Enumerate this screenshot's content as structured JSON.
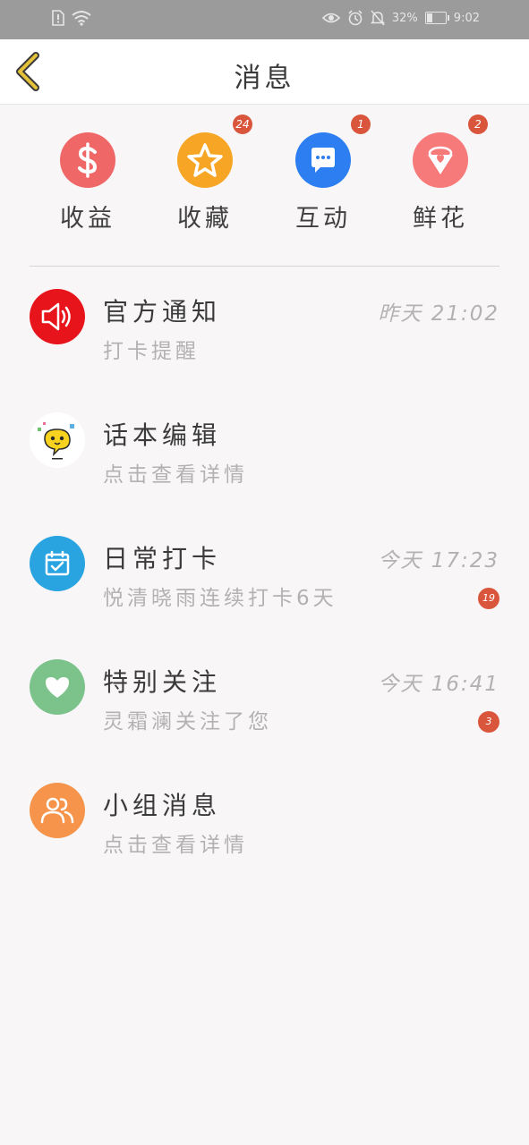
{
  "status_bar": {
    "battery_percent": "32%",
    "time": "9:02"
  },
  "header": {
    "title": "消息",
    "back_icon": "chevron-left-icon",
    "back_color": "#e3c13a"
  },
  "quick_actions": [
    {
      "label": "收益",
      "icon": "dollar-icon",
      "color": "#f06767",
      "badge": ""
    },
    {
      "label": "收藏",
      "icon": "star-icon",
      "color": "#f7a524",
      "badge": "24"
    },
    {
      "label": "互动",
      "icon": "chat-bubble-icon",
      "color": "#2d7ff1",
      "badge": "1"
    },
    {
      "label": "鲜花",
      "icon": "flower-bouquet-icon",
      "color": "#f77a7a",
      "badge": "2"
    }
  ],
  "messages": [
    {
      "title": "官方通知",
      "subtitle": "打卡提醒",
      "time": "昨天  21:02",
      "badge": "",
      "icon": "speaker-icon",
      "color": "#e8141c"
    },
    {
      "title": "话本编辑",
      "subtitle": "点击查看详情",
      "time": "",
      "badge": "",
      "icon": "emoji-chat-icon",
      "color": "#ffffff"
    },
    {
      "title": "日常打卡",
      "subtitle": "悦清晓雨连续打卡6天",
      "time": "今天  17:23",
      "badge": "19",
      "icon": "calendar-check-icon",
      "color": "#29a4e0"
    },
    {
      "title": "特别关注",
      "subtitle": "灵霜澜关注了您",
      "time": "今天  16:41",
      "badge": "3",
      "icon": "heart-icon",
      "color": "#7cc38b"
    },
    {
      "title": "小组消息",
      "subtitle": "点击查看详情",
      "time": "",
      "badge": "",
      "icon": "group-users-icon",
      "color": "#f5944a"
    }
  ]
}
